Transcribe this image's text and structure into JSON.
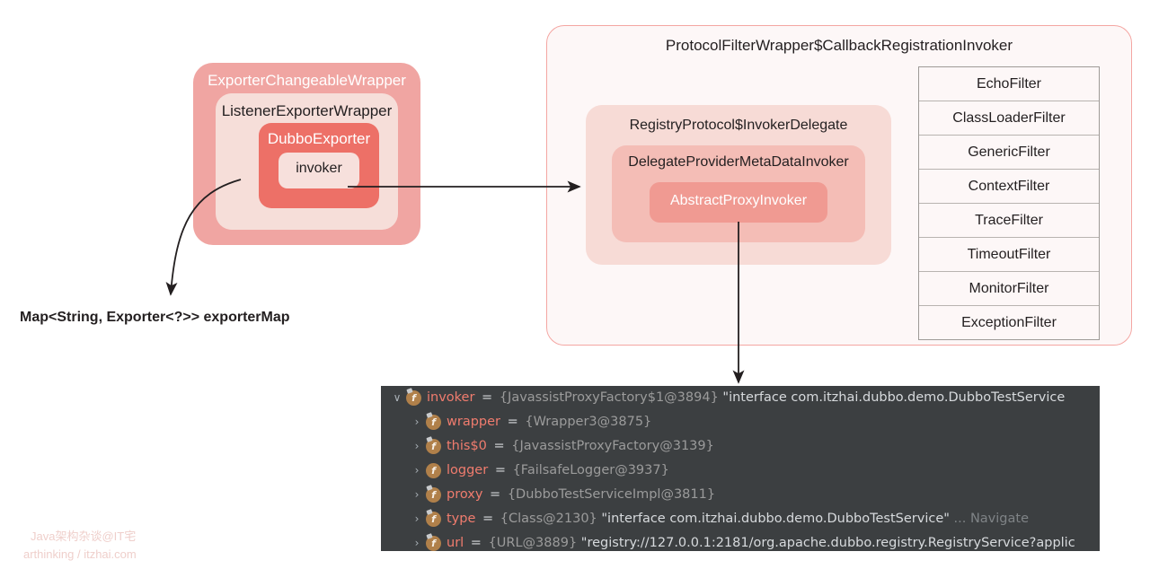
{
  "left_stack": {
    "outer_label": "ExporterChangeableWrapper",
    "middle_label": "ListenerExporterWrapper",
    "inner_label": "DubboExporter",
    "field_label": "invoker"
  },
  "exporter_map": {
    "label": "Map<String, Exporter<?>> exporterMap"
  },
  "right_panel": {
    "title": "ProtocolFilterWrapper$CallbackRegistrationInvoker",
    "delegate_outer_label": "RegistryProtocol$InvokerDelegate",
    "delegate_middle_label": "DelegateProviderMetaDataInvoker",
    "delegate_inner_label": "AbstractProxyInvoker",
    "filters": [
      "EchoFilter",
      "ClassLoaderFilter",
      "GenericFilter",
      "ContextFilter",
      "TraceFilter",
      "TimeoutFilter",
      "MonitorFilter",
      "ExceptionFilter"
    ]
  },
  "debugger": {
    "rows": [
      {
        "chevron": "∨",
        "icon": "f",
        "pinned": true,
        "indent": 0,
        "name": "invoker",
        "eq": "=",
        "ref": "{JavassistProxyFactory$1@3894}",
        "str": "\"interface com.itzhai.dubbo.demo.DubboTestService",
        "nav": ""
      },
      {
        "chevron": "›",
        "icon": "f",
        "pinned": true,
        "indent": 1,
        "name": "wrapper",
        "eq": "=",
        "ref": "{Wrapper3@3875}",
        "str": "",
        "nav": ""
      },
      {
        "chevron": "›",
        "icon": "f",
        "pinned": true,
        "indent": 1,
        "name": "this$0",
        "eq": "=",
        "ref": "{JavassistProxyFactory@3139}",
        "str": "",
        "nav": ""
      },
      {
        "chevron": "›",
        "icon": "f",
        "pinned": false,
        "indent": 1,
        "name": "logger",
        "eq": "=",
        "ref": "{FailsafeLogger@3937}",
        "str": "",
        "nav": ""
      },
      {
        "chevron": "›",
        "icon": "f",
        "pinned": true,
        "indent": 1,
        "name": "proxy",
        "eq": "=",
        "ref": "{DubboTestServiceImpl@3811}",
        "str": "",
        "nav": ""
      },
      {
        "chevron": "›",
        "icon": "f",
        "pinned": true,
        "indent": 1,
        "name": "type",
        "eq": "=",
        "ref": "{Class@2130}",
        "str": "\"interface com.itzhai.dubbo.demo.DubboTestService\"",
        "nav": "... Navigate"
      },
      {
        "chevron": "›",
        "icon": "f",
        "pinned": true,
        "indent": 1,
        "name": "url",
        "eq": "=",
        "ref": "{URL@3889}",
        "str": "\"registry://127.0.0.1:2181/org.apache.dubbo.registry.RegistryService?applic",
        "nav": ""
      }
    ]
  },
  "watermark": {
    "line1": "Java架构杂谈@IT宅",
    "line2": "arthinking / itzhai.com"
  },
  "colors": {
    "outer_wrapper": "#f0a5a2",
    "middle_wrapper": "#f6ded9",
    "inner_wrapper": "#ed7067",
    "panel_border": "#f4a6a2",
    "panel_bg": "#fdf7f7",
    "debugger_bg": "#3c3f41",
    "field_name": "#f07c6e"
  }
}
